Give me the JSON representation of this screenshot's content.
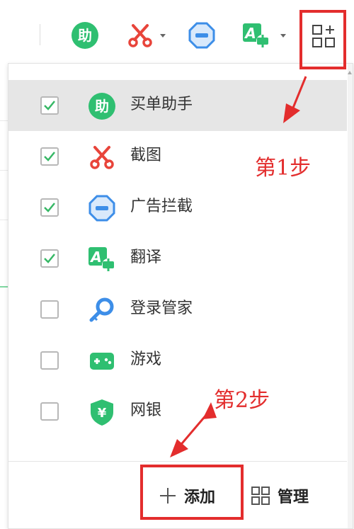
{
  "toolbar": {
    "buttons": [
      {
        "icon": "helper-icon",
        "glyph": "助",
        "has_dropdown": false
      },
      {
        "icon": "scissors-icon",
        "has_dropdown": true
      },
      {
        "icon": "adblock-icon",
        "has_dropdown": false
      },
      {
        "icon": "translate-icon",
        "glyph": "A",
        "has_dropdown": true
      },
      {
        "icon": "app-grid-icon",
        "has_dropdown": false
      }
    ]
  },
  "panel": {
    "items": [
      {
        "label": "买单助手",
        "checked": true,
        "icon": "helper-icon",
        "glyph": "助",
        "highlighted": true
      },
      {
        "label": "截图",
        "checked": true,
        "icon": "scissors-icon"
      },
      {
        "label": "广告拦截",
        "checked": true,
        "icon": "adblock-icon"
      },
      {
        "label": "翻译",
        "checked": true,
        "icon": "translate-icon",
        "glyph": "A"
      },
      {
        "label": "登录管家",
        "checked": false,
        "icon": "key-icon"
      },
      {
        "label": "游戏",
        "checked": false,
        "icon": "gamepad-icon"
      },
      {
        "label": "网银",
        "checked": false,
        "icon": "bank-shield-icon",
        "glyph": "¥"
      }
    ],
    "footer": {
      "add_label": "添加",
      "manage_label": "管理"
    }
  },
  "annotations": {
    "step1": "第1步",
    "step2": "第2步"
  },
  "colors": {
    "green": "#2fbf71",
    "red": "#e8443a",
    "blue": "#3d8ee8",
    "annotation_red": "#e32d2d",
    "check_green": "#37b866"
  }
}
